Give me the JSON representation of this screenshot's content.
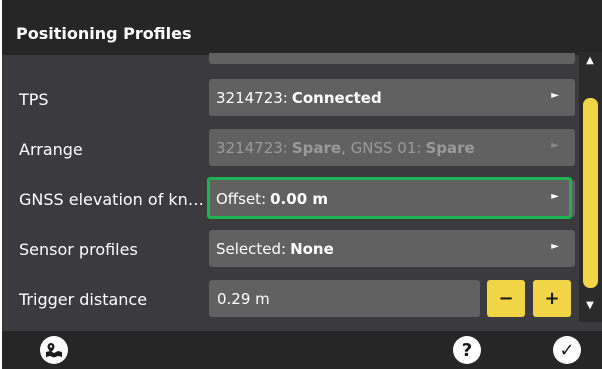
{
  "header": {
    "title": "Positioning Profiles"
  },
  "rows": [
    {
      "label": "TPS",
      "value_prefix": "3214723:",
      "value_bold": "Connected",
      "value_suffix_prefix": "",
      "value_suffix_bold": "",
      "arrow": "►"
    },
    {
      "label": "Arrange",
      "value_prefix": "3214723:",
      "value_bold": "Spare",
      "value_suffix_prefix": ", GNSS 01:",
      "value_suffix_bold": "Spare",
      "arrow": "►",
      "disabled": true
    },
    {
      "label": "GNSS elevation of kn…",
      "value_prefix": "Offset:",
      "value_bold": "0.00 m",
      "arrow": "►",
      "highlighted": true
    },
    {
      "label": "Sensor profiles",
      "value_prefix": "Selected:",
      "value_bold": "None",
      "arrow": "►"
    },
    {
      "label": "Trigger distance",
      "value": "0.29 m",
      "minus": "−",
      "plus": "+"
    }
  ],
  "scrollbar": {
    "up": "▲",
    "down": "▼"
  },
  "footer": {
    "help": "?",
    "confirm": "✓"
  },
  "colors": {
    "accent": "#f2d547",
    "highlight": "#1db254",
    "field_bg": "#616161",
    "panel_bg": "#3b3b3d",
    "bar_bg": "#262626"
  }
}
